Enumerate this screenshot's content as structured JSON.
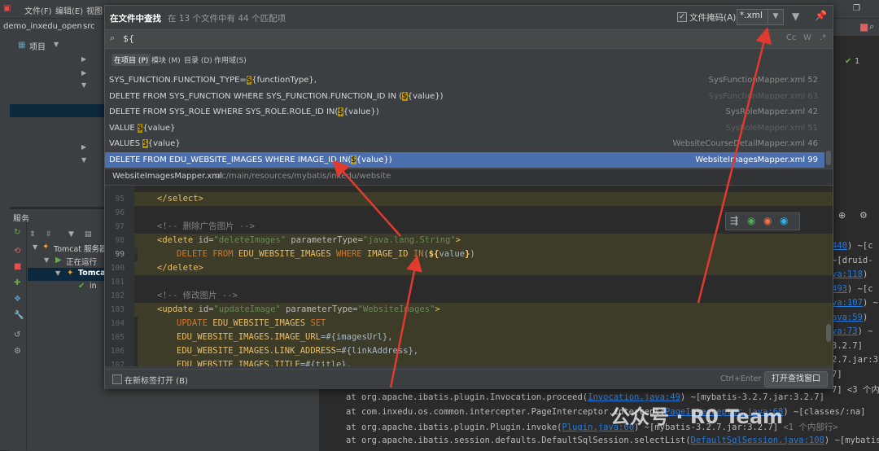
{
  "ide": {
    "menu": [
      "文件(F)",
      "编辑(E)",
      "视图"
    ],
    "project_name": "demo_inxedu_open",
    "project_path": "src",
    "project_tab": "项目",
    "services_title": "服务",
    "tomcat_server": "Tomcat 服务器",
    "running": "正在运行",
    "tomcat_item": "Tomcat",
    "tomcat_child": "in",
    "right_counter": "1",
    "console_lines": [
      {
        "pre": "",
        "link": "440",
        "post": ") ~[c"
      },
      {
        "pre": "~[druid-",
        "link": "",
        "post": ""
      },
      {
        "pre": "",
        "link": "va:118",
        "post": ")"
      },
      {
        "pre": "",
        "link": "493",
        "post": ") ~[c"
      },
      {
        "pre": "",
        "link": "va:107",
        "post": ") ~[myba"
      },
      {
        "pre": "",
        "link": "ava:59",
        "post": ")"
      },
      {
        "pre": "",
        "link": "va:73",
        "post": ") ~"
      },
      {
        "pre": "3.2.7]",
        "link": "",
        "post": ""
      },
      {
        "pre": "2.7.jar:3",
        "link": "",
        "post": ""
      },
      {
        "pre": "7]",
        "link": "",
        "post": ""
      },
      {
        "pre": "7] <3 个内",
        "link": "",
        "post": ""
      }
    ],
    "console_bottom": [
      {
        "pre": "at org.apache.ibatis.plugin.Invocation.proceed(",
        "link": "Invocation.java:49",
        "post": ") ~[mybatis-3.2.7.jar:3.2.7]"
      },
      {
        "pre": "at com.inxedu.os.common.intercepter.PageInterceptor.intercept(",
        "link": "PageInterceptor.java:68",
        "post": ") ~[classes/:na]"
      },
      {
        "pre": "at org.apache.ibatis.plugin.Plugin.invoke(",
        "link": "Plugin.java:60",
        "post": ") ~[mybatis-3.2.7.jar:3.2.7] <1 个内部行>"
      },
      {
        "pre": "at org.apache.ibatis.session.defaults.DefaultSqlSession.selectList(",
        "link": "DefaultSqlSession.java:108",
        "post": ") ~[mybatis-"
      }
    ]
  },
  "find": {
    "title": "在文件中查找",
    "count": "在 13 个文件中有 44 个匹配项",
    "mask_label": "文件掩码(A):",
    "mask_value": "*.xml",
    "mask_checked": true,
    "query": "${",
    "opt_case": "Cc",
    "opt_word": "W",
    "opt_regex": ".*",
    "scopes": [
      "在项目 (P)",
      "模块 (M)",
      "目录 (D)",
      "作用域(S)"
    ],
    "active_scope": 0,
    "results": [
      {
        "pre": "SYS_FUNCTION.FUNCTION_TYPE=",
        "match": "$",
        "post": "{functionType},",
        "file": "SysFunctionMapper.xml 52",
        "dim": false,
        "selected": false
      },
      {
        "pre": "DELETE FROM SYS_FUNCTION WHERE SYS_FUNCTION.FUNCTION_ID IN (",
        "match": "$",
        "post": "{value})",
        "file": "SysFunctionMapper.xml 63",
        "dim": true,
        "selected": false
      },
      {
        "pre": "DELETE FROM SYS_ROLE WHERE SYS_ROLE.ROLE_ID IN(",
        "match": "$",
        "post": "{value})",
        "file": "SysRoleMapper.xml 42",
        "dim": false,
        "selected": false
      },
      {
        "pre": "VALUE ",
        "match": "$",
        "post": "{value}",
        "file": "SysRoleMapper.xml 51",
        "dim": true,
        "selected": false
      },
      {
        "pre": "VALUES ",
        "match": "$",
        "post": "{value}",
        "file": "WebsiteCourseDetailMapper.xml 46",
        "dim": false,
        "selected": false
      },
      {
        "pre": "DELETE FROM EDU_WEBSITE_IMAGES WHERE IMAGE_ID IN(",
        "match": "$",
        "post": "{value})",
        "file": "WebsiteImagesMapper.xml 99",
        "dim": false,
        "selected": true
      }
    ],
    "preview_file": "WebsiteImagesMapper.xml",
    "preview_path": "src/main/resources/mybatis/inxedu/website",
    "new_tab_label": "在新标签打开 (B)",
    "shortcut": "Ctrl+Enter",
    "open_button": "打开查找窗口"
  },
  "code": {
    "lines": [
      {
        "n": "95",
        "parts": [
          [
            "tag",
            "</select>"
          ]
        ],
        "bk": true,
        "indent": 1
      },
      {
        "n": "96",
        "parts": [],
        "bk": false,
        "indent": 0
      },
      {
        "n": "97",
        "parts": [
          [
            "cmt",
            "<!-- 删除广告图片 -->"
          ]
        ],
        "bk": false,
        "indent": 1
      },
      {
        "n": "98",
        "parts": [
          [
            "tag",
            "<delete "
          ],
          [
            "attr",
            "id="
          ],
          [
            "str",
            "\"deleteImages\""
          ],
          [
            "attr",
            " parameterType="
          ],
          [
            "str",
            "\"java.lang.String\""
          ],
          [
            "tag",
            ">"
          ]
        ],
        "bk": true,
        "indent": 1
      },
      {
        "n": "99",
        "parts": [
          [
            "kw",
            "DELETE FROM "
          ],
          [
            "tb",
            "EDU_WEBSITE_IMAGES "
          ],
          [
            "kw",
            "WHERE "
          ],
          [
            "tb",
            "IMAGE_ID "
          ],
          [
            "kw",
            "IN"
          ],
          [
            "tx",
            "("
          ],
          [
            "hi",
            "${"
          ],
          [
            "tx",
            "value"
          ],
          [
            "hi",
            "}"
          ],
          [
            "tx",
            ")"
          ]
        ],
        "bk": true,
        "indent": 2
      },
      {
        "n": "100",
        "parts": [
          [
            "tag",
            "</delete>"
          ]
        ],
        "bk": true,
        "indent": 1
      },
      {
        "n": "101",
        "parts": [],
        "bk": false,
        "indent": 0
      },
      {
        "n": "102",
        "parts": [
          [
            "cmt",
            "<!-- 修改图片 -->"
          ]
        ],
        "bk": false,
        "indent": 1
      },
      {
        "n": "103",
        "parts": [
          [
            "tag",
            "<update "
          ],
          [
            "attr",
            "id="
          ],
          [
            "str",
            "\"updateImage\""
          ],
          [
            "attr",
            " parameterType="
          ],
          [
            "str",
            "\"WebsiteImages\""
          ],
          [
            "tag",
            ">"
          ]
        ],
        "bk": true,
        "indent": 1
      },
      {
        "n": "104",
        "parts": [
          [
            "kw",
            "UPDATE "
          ],
          [
            "tb",
            "EDU_WEBSITE_IMAGES "
          ],
          [
            "kw",
            "SET"
          ]
        ],
        "bk": true,
        "indent": 2
      },
      {
        "n": "105",
        "parts": [
          [
            "tb",
            "EDU_WEBSITE_IMAGES.IMAGE_URL"
          ],
          [
            "tx",
            "=#{imagesUrl},"
          ]
        ],
        "bk": true,
        "indent": 2
      },
      {
        "n": "106",
        "parts": [
          [
            "tb",
            "EDU_WEBSITE_IMAGES.LINK_ADDRESS"
          ],
          [
            "tx",
            "=#{linkAddress},"
          ]
        ],
        "bk": true,
        "indent": 2
      },
      {
        "n": "107",
        "parts": [
          [
            "tb",
            "EDU_WEBSITE_IMAGES.TITLE"
          ],
          [
            "tx",
            "=#{title},"
          ]
        ],
        "bk": true,
        "indent": 2
      }
    ]
  },
  "watermark": "公众号 · R0 Team",
  "colors": {
    "accent": "#4b6eaf",
    "match": "#b89500",
    "arrow": "#e23a2e"
  }
}
